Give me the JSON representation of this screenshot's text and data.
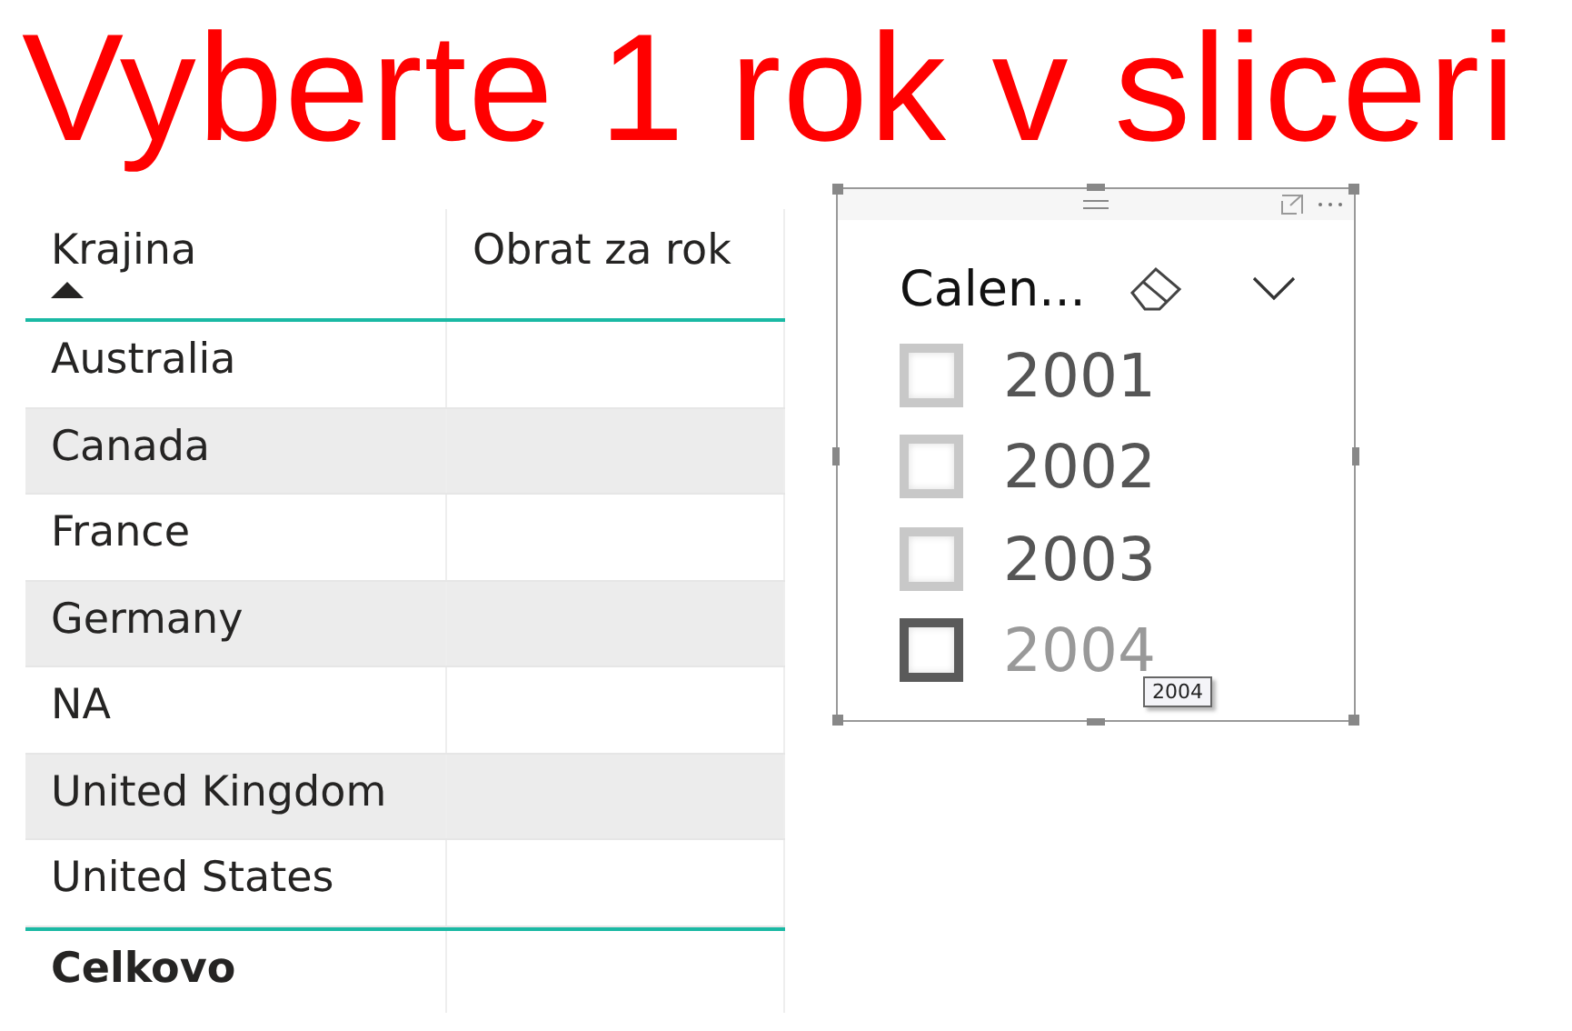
{
  "title": "Vyberte 1 rok v sliceri",
  "table": {
    "columns": [
      {
        "label": "Krajina",
        "sorted": true
      },
      {
        "label": "Obrat za rok",
        "sorted": false
      }
    ],
    "rows": [
      {
        "cells": [
          "Australia",
          ""
        ]
      },
      {
        "cells": [
          "Canada",
          ""
        ]
      },
      {
        "cells": [
          "France",
          ""
        ]
      },
      {
        "cells": [
          "Germany",
          ""
        ]
      },
      {
        "cells": [
          "NA",
          ""
        ]
      },
      {
        "cells": [
          "United Kingdom",
          ""
        ]
      },
      {
        "cells": [
          "United States",
          ""
        ]
      }
    ],
    "total": {
      "cells": [
        "Celkovo",
        ""
      ]
    }
  },
  "slicer": {
    "title": "Calen...",
    "items": [
      {
        "label": "2001",
        "checked": false,
        "hovered": false
      },
      {
        "label": "2002",
        "checked": false,
        "hovered": false
      },
      {
        "label": "2003",
        "checked": false,
        "hovered": false
      },
      {
        "label": "2004",
        "checked": false,
        "hovered": true
      }
    ],
    "tooltip": "2004"
  }
}
